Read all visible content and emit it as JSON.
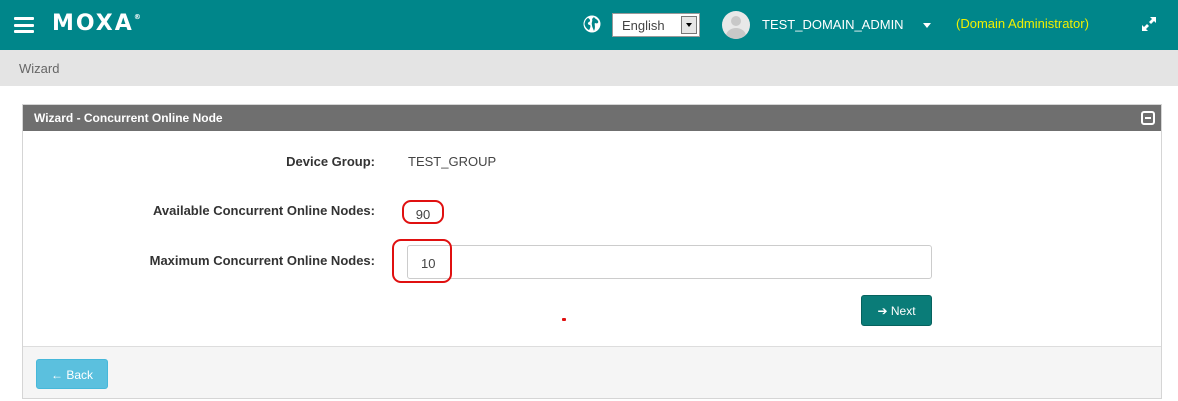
{
  "header": {
    "logo_text": "MOXA",
    "logo_mark": "®",
    "language": "English",
    "username": "TEST_DOMAIN_ADMIN",
    "role": "(Domain Administrator)",
    "brand_color": "#00868a",
    "icons": [
      "menu-icon",
      "globe-icon",
      "user-avatar",
      "chevron-down-icon",
      "expand-icon"
    ]
  },
  "breadcrumb": "Wizard",
  "panel": {
    "title": "Wizard - Concurrent Online Node",
    "device_group_label": "Device Group:",
    "device_group_value": "TEST_GROUP",
    "available_label": "Available Concurrent Online Nodes:",
    "available_value": "90",
    "maximum_label": "Maximum Concurrent Online Nodes:",
    "maximum_value": "10",
    "next_label": "➔ Next",
    "back_label": "← Back"
  }
}
